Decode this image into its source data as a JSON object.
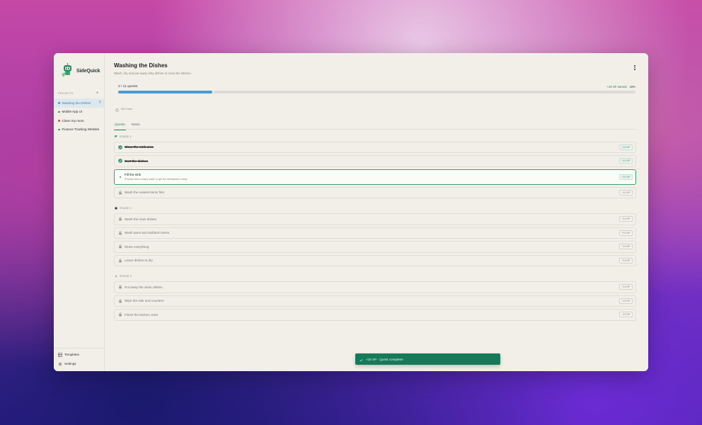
{
  "app": {
    "name": "SideQuick"
  },
  "sidebar": {
    "projects_label": "PROJECTS",
    "add_symbol": "+",
    "items": [
      {
        "label": "Washing the Dishes",
        "dot_color": "#4a9bd1",
        "active": true
      },
      {
        "label": "Mobile App UI",
        "dot_color": "#2e8b62",
        "active": false
      },
      {
        "label": "Clean my room",
        "dot_color": "#d9534f",
        "active": false
      },
      {
        "label": "Finance Tracking Website",
        "dot_color": "#2e8b62",
        "active": false
      }
    ],
    "bottom": [
      {
        "label": "Templates",
        "icon": "templates-icon"
      },
      {
        "label": "Settings",
        "icon": "gear-icon"
      }
    ]
  },
  "header": {
    "title": "Washing the Dishes",
    "subtitle": "Wash, dry and put away dirty dishes to reset the kitchen."
  },
  "progress": {
    "count_text": "2 / 11 quests",
    "xp_text": "+20 XP earned",
    "percent_text": "18%",
    "fraction": 0.182
  },
  "timer": {
    "label": "Set Timer"
  },
  "tabs": [
    {
      "label": "Quests",
      "active": true
    },
    {
      "label": "Notes",
      "active": false
    }
  ],
  "stages": [
    {
      "label": "STAGE 1",
      "quests": [
        {
          "name": "Clear the sink area",
          "xp": "+10 XP",
          "status": "done"
        },
        {
          "name": "Sort the dishes",
          "xp": "+10 XP",
          "status": "done"
        },
        {
          "name": "Fill the sink",
          "desc": "Prepare warm soapy water or get the dishwasher ready.",
          "xp": "+10 XP",
          "status": "current"
        },
        {
          "name": "Wash the easiest items first",
          "xp": "+10 XP",
          "status": "locked"
        }
      ]
    },
    {
      "label": "STAGE 2",
      "quests": [
        {
          "name": "Wash the main dishes",
          "xp": "+10 XP",
          "status": "locked"
        },
        {
          "name": "Wash pans and stubborn items",
          "xp": "+10 XP",
          "status": "locked"
        },
        {
          "name": "Rinse everything",
          "xp": "+10 XP",
          "status": "locked"
        },
        {
          "name": "Leave dishes to dry",
          "xp": "+10 XP",
          "status": "locked"
        }
      ]
    },
    {
      "label": "STAGE 3",
      "quests": [
        {
          "name": "Put away the clean dishes",
          "xp": "+10 XP",
          "status": "locked"
        },
        {
          "name": "Wipe the sink and counters",
          "xp": "+10 XP",
          "status": "locked"
        },
        {
          "name": "Finish the kitchen reset",
          "xp": "+10 XP",
          "status": "locked"
        }
      ]
    }
  ],
  "toast": {
    "text": "+10 XP · Quest complete!"
  },
  "colors": {
    "accent": "#2e8b62",
    "progress": "#4a9bd1",
    "toast": "#157a5a"
  }
}
